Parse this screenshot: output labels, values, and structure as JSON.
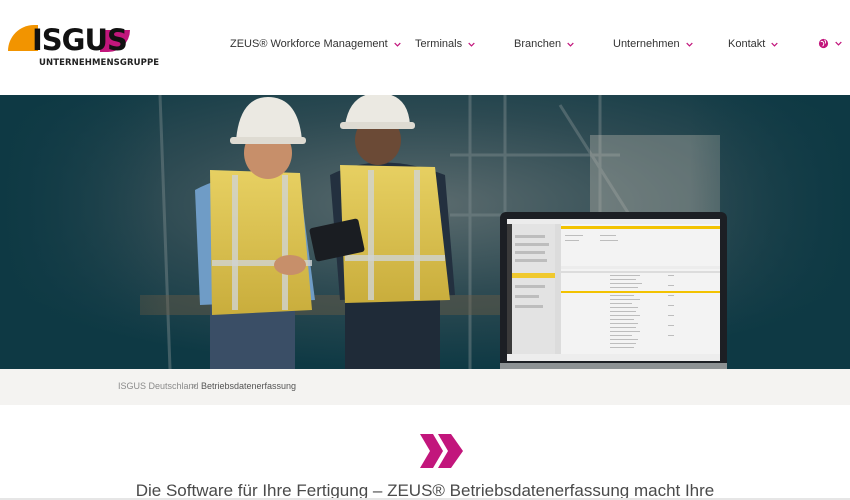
{
  "brand": {
    "name": "ISGUS",
    "subtitle": "UNTERNEHMENSGRUPPE",
    "colors": {
      "orange": "#f29400",
      "magenta": "#c2167c",
      "teal": "#0e3944"
    }
  },
  "nav": {
    "items": [
      {
        "label": "ZEUS® Workforce Management"
      },
      {
        "label": "Terminals"
      },
      {
        "label": "Branchen"
      },
      {
        "label": "Unternehmen"
      },
      {
        "label": "Kontakt"
      }
    ],
    "language_icon": "globe-icon"
  },
  "hero": {
    "image": "workers-with-tablet-and-laptop"
  },
  "breadcrumb": {
    "home": "ISGUS Deutschland",
    "separator": ">",
    "current": "Betriebsdatenerfassung"
  },
  "content": {
    "decor_icon": "double-chevron-right-icon",
    "intro_text": "Die Software für Ihre Fertigung – ZEUS® Betriebsdatenerfassung macht Ihre"
  }
}
